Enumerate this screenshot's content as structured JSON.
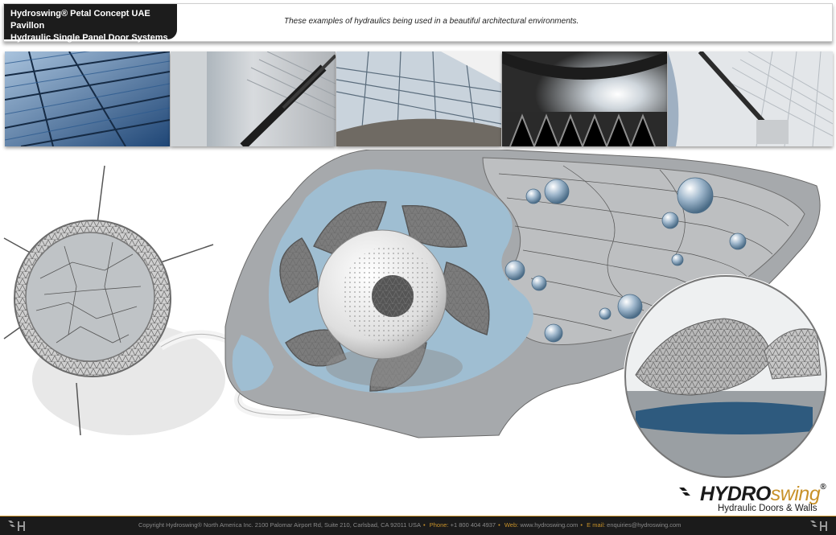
{
  "header": {
    "title_line1": "Hydroswing® Petal Concept UAE Pavillon",
    "title_line2": "Hydraulic Single Panel Door Systems",
    "caption": "These examples of hydraulics being used in a beautiful architectural environments."
  },
  "photos": [
    {
      "icon": "glass-canopy-photo",
      "accent": "#2f5a8e"
    },
    {
      "icon": "hydraulic-cylinder-photo",
      "accent": "#b9bcc0"
    },
    {
      "icon": "roof-structure-photo",
      "accent": "#9aa6b2"
    },
    {
      "icon": "interior-sunburst-photo",
      "accent": "#3b3b3b"
    },
    {
      "icon": "lattice-arm-photo",
      "accent": "#cfd3d7"
    }
  ],
  "brand": {
    "name_part1": "HYDRO",
    "name_part2": "swing",
    "registered": "®",
    "tagline": "Hydraulic Doors & Walls"
  },
  "footer": {
    "copyright": "Copyright Hydroswing® North America Inc. 2100 Palomar Airport Rd, Suite 210, Carlsbad, CA 92011 USA",
    "phone_label": "Phone:",
    "phone": "+1 800 404 4937",
    "web_label": "Web:",
    "web": "www.hydroswing.com",
    "email_label": "E mail:",
    "email": "enquiries@hydroswing.com"
  },
  "colors": {
    "accent": "#c8922a",
    "footer_bg": "#1b1b1b",
    "water": "#9fbed2"
  }
}
